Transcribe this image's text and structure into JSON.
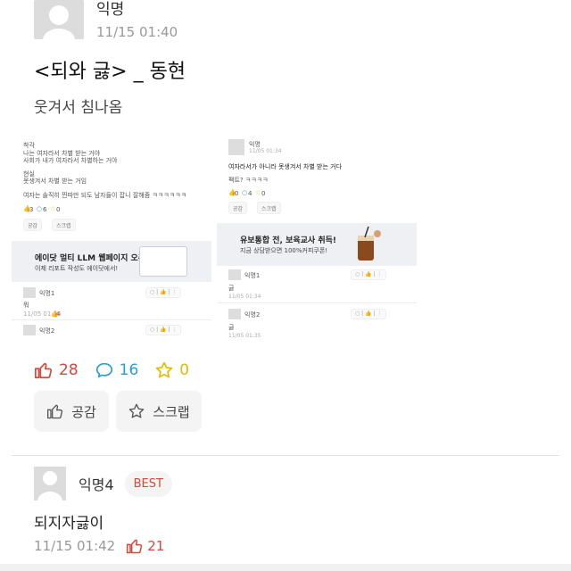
{
  "post": {
    "author": "익명",
    "datetime": "11/15 01:40",
    "title": "<되와 긇> _ 동현",
    "body": "웃겨서 침나옴"
  },
  "screenshot_left": {
    "lines": [
      "착각",
      "나는 여자라서 차별 받는 거야",
      "사회가 내가 여자라서 차별하는 거야",
      "현실",
      "못생겨서 차별 받는 거임",
      "여자는 솔직히 찐따만 되도 남자들이 잡니 잘해줌 ㅋㅋㅋㅋㅋㅋ"
    ],
    "reaction_counts": [
      "3",
      "6",
      "0"
    ],
    "buttons": [
      "공감",
      "스크랩"
    ],
    "banner_title": "에이닷 멀티 LLM 웹페이지 오픈!",
    "banner_sub": "이제 리포트 작성도 에이닷에서!",
    "comments": [
      {
        "author": "익명1",
        "text": "뭐",
        "time": "11/05 01:36",
        "likes": "4"
      },
      {
        "author": "익명2",
        "text": "",
        "time": "",
        "likes": ""
      }
    ]
  },
  "screenshot_right": {
    "author": "익명",
    "time": "11/05 01:34",
    "title": "여자라서가 아니라 못생겨서 차별 받는 거다",
    "body": "팩트? ㅋㅋㅋㅋ",
    "reaction_counts": [
      "0",
      "4",
      "0"
    ],
    "buttons": [
      "공감",
      "스크랩"
    ],
    "banner_title": "유보통합 전, 보육교사 취득!",
    "banner_sub": "지금 상담받으면 100%커피쿠폰!",
    "comments": [
      {
        "author": "익명1",
        "text": "긇",
        "time": "11/05 01:34"
      },
      {
        "author": "익명2",
        "text": "긇",
        "time": "11/05 01:35"
      }
    ]
  },
  "reactions": {
    "likes": "28",
    "comments": "16",
    "scraps": "0",
    "colors": {
      "like": "#d9453a",
      "comment": "#2a9bd6",
      "scrap": "#e6b800"
    }
  },
  "actions": {
    "like_label": "공감",
    "scrap_label": "스크랩"
  },
  "comment": {
    "author": "익명4",
    "badge": "BEST",
    "text": "되지자긇이",
    "datetime": "11/15 01:42",
    "likes": "21"
  }
}
